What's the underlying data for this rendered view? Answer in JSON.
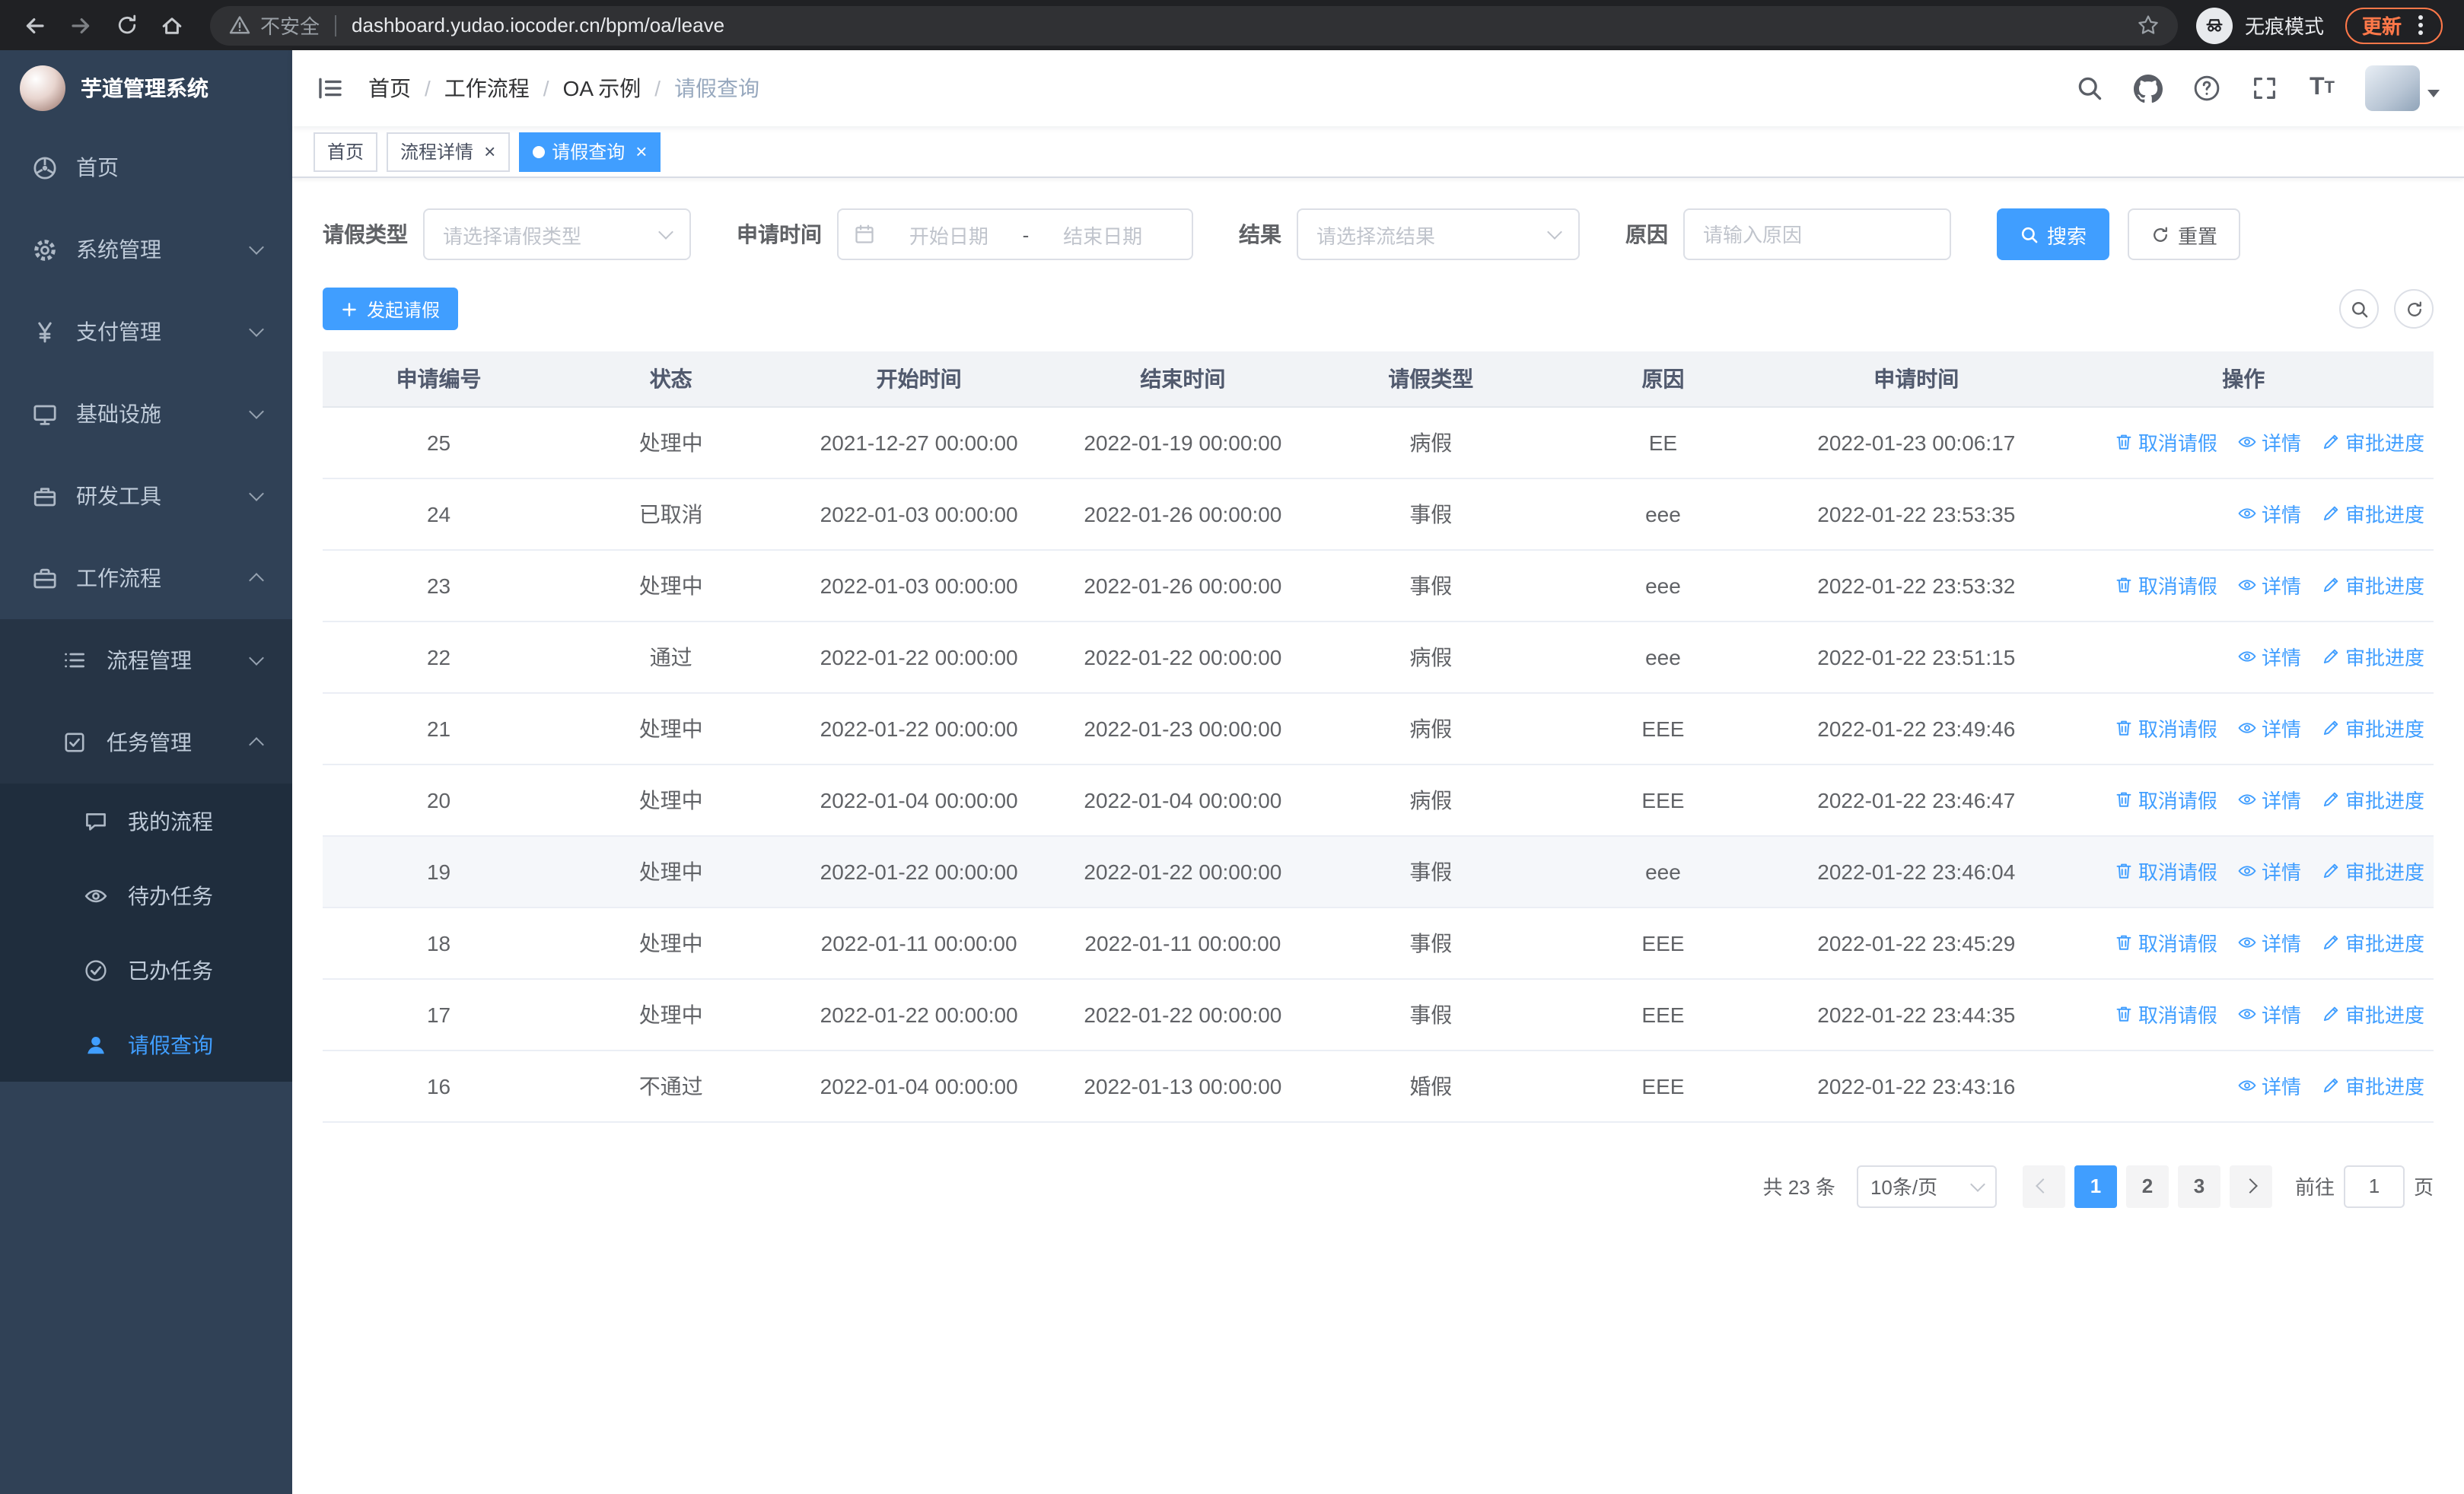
{
  "colors": {
    "accent": "#409eff",
    "sidebar_bg": "#304156",
    "sidebar_submenu_bg": "#263445",
    "sidebar_submenu2_bg": "#1f2d3d",
    "update_chip": "#ff7849",
    "table_header_bg": "#f1f3f6"
  },
  "browser": {
    "warning": "不安全",
    "url": "dashboard.yudao.iocoder.cn/bpm/oa/leave",
    "incognito": "无痕模式",
    "update": "更新"
  },
  "sidebar": {
    "title": "芋道管理系统",
    "items": [
      {
        "label": "首页",
        "icon": "dashboard-icon"
      },
      {
        "label": "系统管理",
        "icon": "gear-icon"
      },
      {
        "label": "支付管理",
        "icon": "yen-icon"
      },
      {
        "label": "基础设施",
        "icon": "monitor-icon"
      },
      {
        "label": "研发工具",
        "icon": "toolbox-icon"
      },
      {
        "label": "工作流程",
        "icon": "briefcase-icon"
      }
    ],
    "workflow_children": [
      {
        "label": "流程管理",
        "icon": "list-icon"
      },
      {
        "label": "任务管理",
        "icon": "tasks-icon"
      }
    ],
    "task_children": [
      {
        "label": "我的流程",
        "icon": "chat-icon"
      },
      {
        "label": "待办任务",
        "icon": "eye-icon"
      },
      {
        "label": "已办任务",
        "icon": "check-icon"
      },
      {
        "label": "请假查询",
        "icon": "user-icon",
        "active": true
      }
    ]
  },
  "header": {
    "breadcrumb": [
      "首页",
      "工作流程",
      "OA 示例",
      "请假查询"
    ],
    "breadcrumb_separator": "/"
  },
  "tabs": [
    {
      "label": "首页",
      "closable": false,
      "active": false
    },
    {
      "label": "流程详情",
      "closable": true,
      "active": false
    },
    {
      "label": "请假查询",
      "closable": true,
      "active": true
    }
  ],
  "tabs_close": "×",
  "filters": {
    "leave_type_label": "请假类型",
    "leave_type_placeholder": "请选择请假类型",
    "apply_time_label": "申请时间",
    "start_date_placeholder": "开始日期",
    "range_separator": "-",
    "end_date_placeholder": "结束日期",
    "result_label": "结果",
    "result_placeholder": "请选择流结果",
    "reason_label": "原因",
    "reason_placeholder": "请输入原因",
    "search_button": "搜索",
    "reset_button": "重置"
  },
  "toolbar": {
    "create_button": "发起请假"
  },
  "table": {
    "columns": [
      "申请编号",
      "状态",
      "开始时间",
      "结束时间",
      "请假类型",
      "原因",
      "申请时间",
      "操作"
    ],
    "action_labels": {
      "cancel": "取消请假",
      "detail": "详情",
      "progress": "审批进度"
    },
    "action_icons": {
      "cancel": "trash-icon",
      "detail": "eye-icon",
      "progress": "edit-icon"
    },
    "rows": [
      {
        "id": "25",
        "status": "处理中",
        "start": "2021-12-27 00:00:00",
        "end": "2022-01-19 00:00:00",
        "type": "病假",
        "reason": "EE",
        "applied": "2022-01-23 00:06:17",
        "actions": [
          "cancel",
          "detail",
          "progress"
        ]
      },
      {
        "id": "24",
        "status": "已取消",
        "start": "2022-01-03 00:00:00",
        "end": "2022-01-26 00:00:00",
        "type": "事假",
        "reason": "eee",
        "applied": "2022-01-22 23:53:35",
        "actions": [
          "detail",
          "progress"
        ]
      },
      {
        "id": "23",
        "status": "处理中",
        "start": "2022-01-03 00:00:00",
        "end": "2022-01-26 00:00:00",
        "type": "事假",
        "reason": "eee",
        "applied": "2022-01-22 23:53:32",
        "actions": [
          "cancel",
          "detail",
          "progress"
        ]
      },
      {
        "id": "22",
        "status": "通过",
        "start": "2022-01-22 00:00:00",
        "end": "2022-01-22 00:00:00",
        "type": "病假",
        "reason": "eee",
        "applied": "2022-01-22 23:51:15",
        "actions": [
          "detail",
          "progress"
        ]
      },
      {
        "id": "21",
        "status": "处理中",
        "start": "2022-01-22 00:00:00",
        "end": "2022-01-23 00:00:00",
        "type": "病假",
        "reason": "EEE",
        "applied": "2022-01-22 23:49:46",
        "actions": [
          "cancel",
          "detail",
          "progress"
        ]
      },
      {
        "id": "20",
        "status": "处理中",
        "start": "2022-01-04 00:00:00",
        "end": "2022-01-04 00:00:00",
        "type": "病假",
        "reason": "EEE",
        "applied": "2022-01-22 23:46:47",
        "actions": [
          "cancel",
          "detail",
          "progress"
        ]
      },
      {
        "id": "19",
        "status": "处理中",
        "start": "2022-01-22 00:00:00",
        "end": "2022-01-22 00:00:00",
        "type": "事假",
        "reason": "eee",
        "applied": "2022-01-22 23:46:04",
        "actions": [
          "cancel",
          "detail",
          "progress"
        ],
        "hover": true
      },
      {
        "id": "18",
        "status": "处理中",
        "start": "2022-01-11 00:00:00",
        "end": "2022-01-11 00:00:00",
        "type": "事假",
        "reason": "EEE",
        "applied": "2022-01-22 23:45:29",
        "actions": [
          "cancel",
          "detail",
          "progress"
        ]
      },
      {
        "id": "17",
        "status": "处理中",
        "start": "2022-01-22 00:00:00",
        "end": "2022-01-22 00:00:00",
        "type": "事假",
        "reason": "EEE",
        "applied": "2022-01-22 23:44:35",
        "actions": [
          "cancel",
          "detail",
          "progress"
        ]
      },
      {
        "id": "16",
        "status": "不通过",
        "start": "2022-01-04 00:00:00",
        "end": "2022-01-13 00:00:00",
        "type": "婚假",
        "reason": "EEE",
        "applied": "2022-01-22 23:43:16",
        "actions": [
          "detail",
          "progress"
        ]
      }
    ]
  },
  "pagination": {
    "total_text": "共 23 条",
    "page_size": "10条/页",
    "pages": [
      "1",
      "2",
      "3"
    ],
    "active_page": "1",
    "goto_prefix": "前往",
    "goto_value": "1",
    "goto_suffix": "页"
  }
}
